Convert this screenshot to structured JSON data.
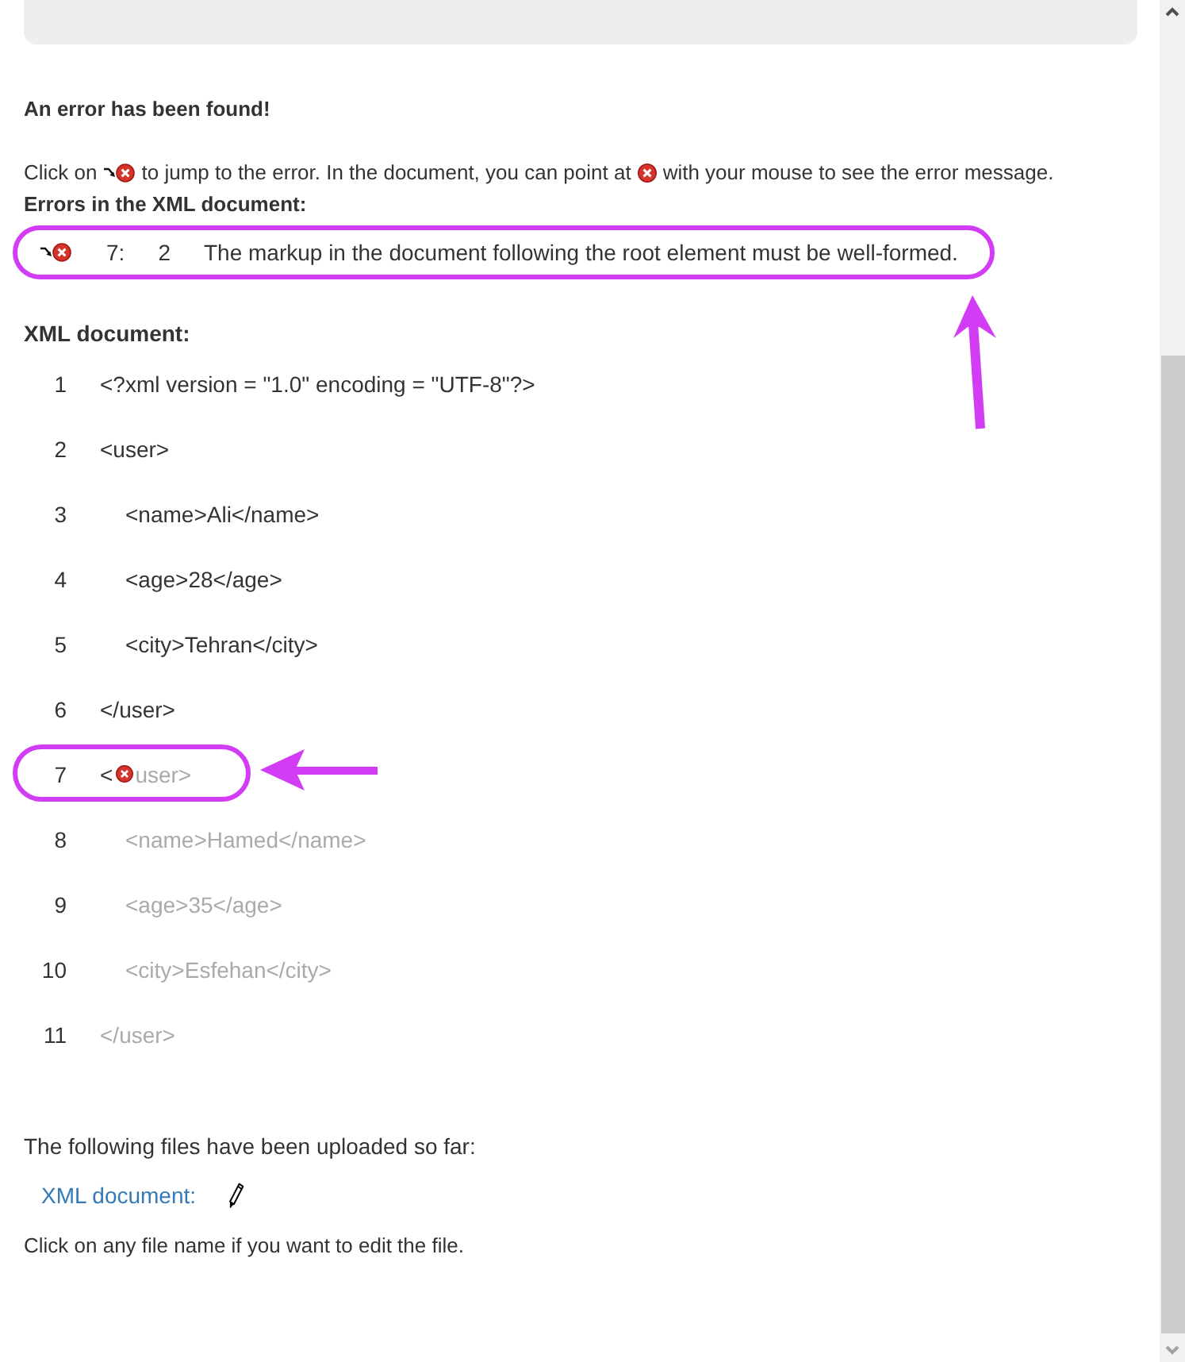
{
  "result": {
    "heading": "An error has been found!",
    "instruction": [
      {
        "kind": "text",
        "text": "Click on"
      },
      {
        "kind": "jump-icon"
      },
      {
        "kind": "text",
        "text": "to jump to the error. In the document, you can point at"
      },
      {
        "kind": "error-icon"
      },
      {
        "kind": "text",
        "text": "with your mouse to see the error message."
      }
    ]
  },
  "errors": {
    "title": "Errors in the XML document:",
    "items": [
      {
        "line": "7:",
        "column": "2",
        "message": "The markup in the document following the root element must be well-formed.",
        "marked": true
      }
    ]
  },
  "document": {
    "title": "XML document:",
    "lines": [
      {
        "number": "1",
        "marked": false,
        "parts": [
          {
            "kind": "text",
            "text": "<?xml version = \"1.0\" encoding = \"UTF-8\"?>",
            "faded": false
          }
        ]
      },
      {
        "number": "2",
        "marked": false,
        "parts": [
          {
            "kind": "text",
            "text": "<user>",
            "faded": false
          }
        ],
        "children": [
          {
            "number": "3",
            "marked": false,
            "parts": [
              {
                "kind": "text",
                "text": "<name>Ali</name>",
                "faded": false
              }
            ]
          },
          {
            "number": "4",
            "marked": false,
            "parts": [
              {
                "kind": "text",
                "text": "<age>28</age>",
                "faded": false
              }
            ]
          },
          {
            "number": "5",
            "marked": false,
            "parts": [
              {
                "kind": "text",
                "text": "<city>Tehran</city>",
                "faded": false
              }
            ]
          }
        ]
      },
      {
        "number": "6",
        "marked": false,
        "parts": [
          {
            "kind": "text",
            "text": "</user>",
            "faded": false
          }
        ]
      },
      {
        "number": "7",
        "marked": true,
        "parts": [
          {
            "kind": "text",
            "text": "<",
            "faded": false
          },
          {
            "kind": "error-icon"
          },
          {
            "kind": "text",
            "text": "user>",
            "faded": true
          }
        ],
        "children": [
          {
            "number": "8",
            "marked": false,
            "parts": [
              {
                "kind": "text",
                "text": "<name>Hamed</name>",
                "faded": true
              }
            ]
          },
          {
            "number": "9",
            "marked": false,
            "parts": [
              {
                "kind": "text",
                "text": "<age>35</age>",
                "faded": true
              }
            ]
          },
          {
            "number": "10",
            "marked": false,
            "parts": [
              {
                "kind": "text",
                "text": "<city>Esfehan</city>",
                "faded": true
              }
            ]
          }
        ]
      },
      {
        "number": "11",
        "marked": false,
        "parts": [
          {
            "kind": "text",
            "text": "</user>",
            "faded": true
          }
        ]
      }
    ]
  },
  "uploads": {
    "intro": "The following files have been uploaded so far:",
    "files": [
      {
        "name": "XML document:"
      }
    ],
    "hint": "Click on any file name if you want to edit the file."
  }
}
